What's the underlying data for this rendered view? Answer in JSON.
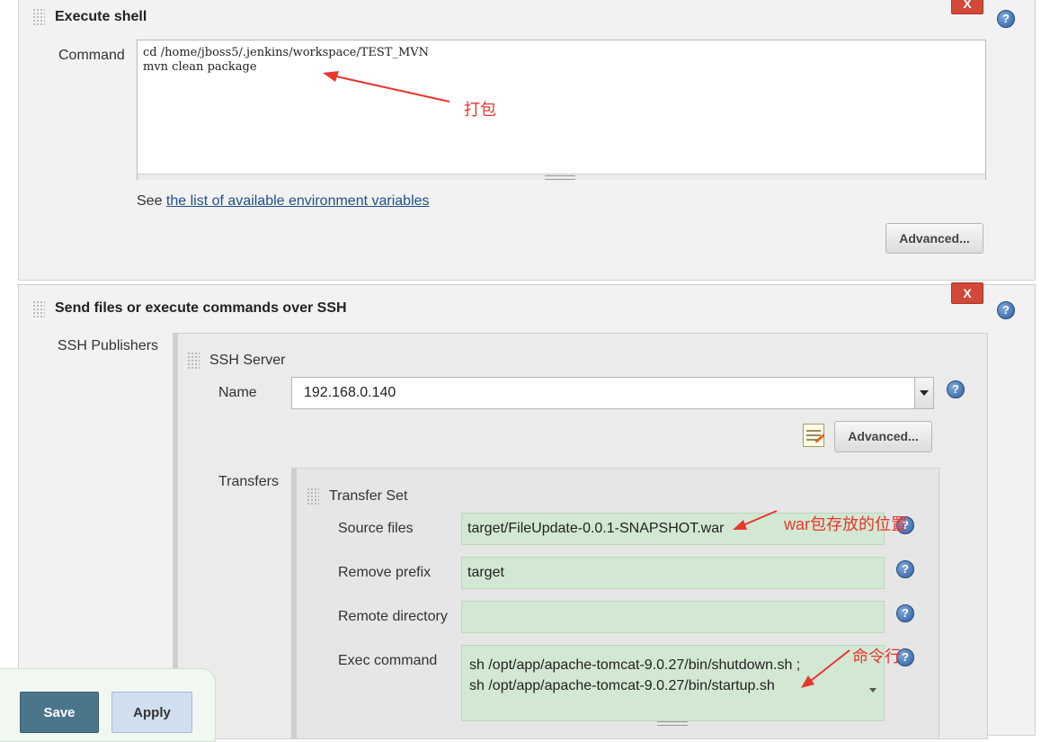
{
  "execute_shell": {
    "title": "Execute shell",
    "command_label": "Command",
    "command_lines": [
      "cd /home/jboss5/.jenkins/workspace/TEST_MVN",
      "mvn clean package"
    ],
    "see_text": "See ",
    "env_link": "the list of available environment variables",
    "advanced_label": "Advanced...",
    "annotation": "打包"
  },
  "ssh": {
    "title": "Send files or execute commands over SSH",
    "publishers_label": "SSH Publishers",
    "server_title": "SSH Server",
    "name_label": "Name",
    "name_value": "192.168.0.140",
    "advanced_label": "Advanced...",
    "transfers_label": "Transfers",
    "transfer_set_title": "Transfer Set",
    "source_files_label": "Source files",
    "source_files_value": "target/FileUpdate-0.0.1-SNAPSHOT.war",
    "source_annotation": "war包存放的位置",
    "remove_prefix_label": "Remove prefix",
    "remove_prefix_value": "target",
    "remote_directory_label": "Remote directory",
    "remote_directory_value": "",
    "exec_command_label": "Exec command",
    "exec_command_lines": [
      "sh /opt/app/apache-tomcat-9.0.27/bin/shutdown.sh ;",
      "sh /opt/app/apache-tomcat-9.0.27/bin/startup.sh"
    ],
    "exec_annotation": "命令行"
  },
  "footer": {
    "save_label": "Save",
    "apply_label": "Apply"
  },
  "common": {
    "delete_label": "X",
    "help_glyph": "?"
  },
  "colors": {
    "delete": "#d24939",
    "field_green": "#d2e8d2",
    "annotation": "#e8362d",
    "save": "#4b758b"
  }
}
